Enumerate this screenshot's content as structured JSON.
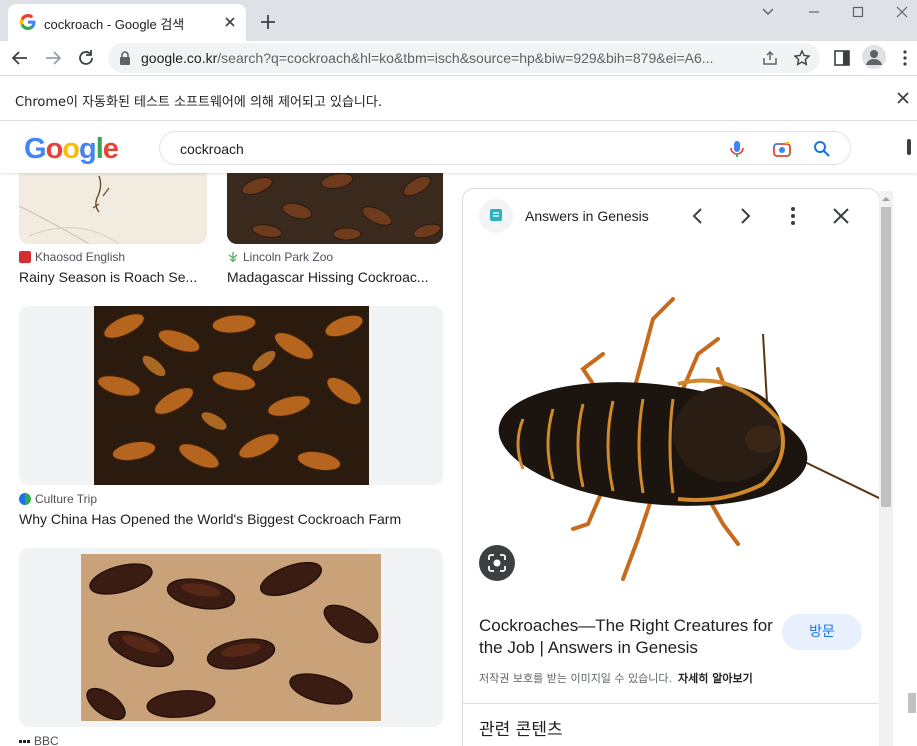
{
  "browser": {
    "tab_title": "cockroach - Google 검색",
    "url_domain": "google.co.kr",
    "url_rest": "/search?q=cockroach&hl=ko&tbm=isch&source=hp&biw=929&bih=879&ei=A6...",
    "infobar_text": "Chrome이 자동화된 테스트 소프트웨어에 의해 제어되고 있습니다."
  },
  "google": {
    "logo_letters": [
      "G",
      "o",
      "o",
      "g",
      "l",
      "e"
    ],
    "logo_colors": [
      "#4285F4",
      "#EA4335",
      "#FBBC05",
      "#4285F4",
      "#34A853",
      "#EA4335"
    ],
    "query": "cockroach"
  },
  "results": [
    {
      "source": "Khaosod English",
      "title": "Rainy Season is Roach Se..."
    },
    {
      "source": "Lincoln Park Zoo",
      "title": "Madagascar Hissing Cockroac..."
    },
    {
      "source": "Culture Trip",
      "title": "Why China Has Opened the World's Biggest Cockroach Farm"
    },
    {
      "source": "BBC",
      "title": ""
    }
  ],
  "panel": {
    "site": "Answers in Genesis",
    "title": "Cockroaches—The Right Creatures for the Job | Answers in Genesis",
    "visit_label": "방문",
    "copyright": "저작권 보호를 받는 이미지일 수 있습니다.",
    "learn_more": "자세히 알아보기",
    "related": "관련 콘텐츠"
  },
  "colors": {
    "accent": "#1a73e8",
    "tabstrip": "#dee1e6"
  }
}
